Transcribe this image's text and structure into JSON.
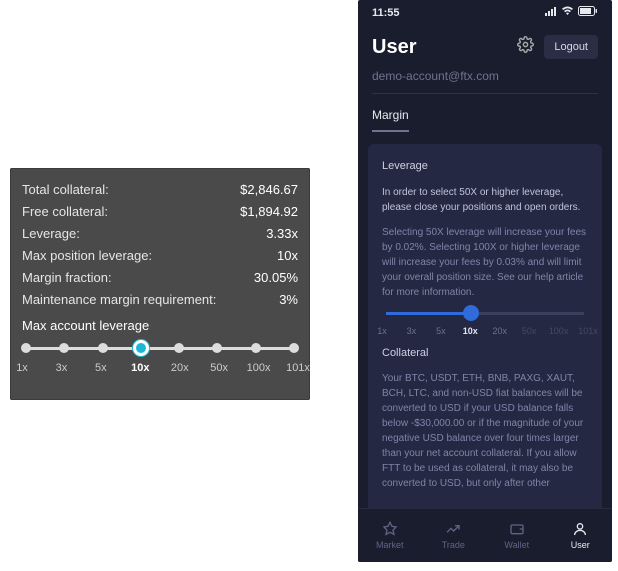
{
  "left": {
    "stats": [
      {
        "label": "Total collateral:",
        "value": "$2,846.67"
      },
      {
        "label": "Free collateral:",
        "value": "$1,894.92"
      },
      {
        "label": "Leverage:",
        "value": "3.33x"
      },
      {
        "label": "Max position leverage:",
        "value": "10x"
      },
      {
        "label": "Margin fraction:",
        "value": "30.05%"
      },
      {
        "label": "Maintenance margin requirement:",
        "value": "3%"
      }
    ],
    "slider_title": "Max account leverage",
    "options": [
      "1x",
      "3x",
      "5x",
      "10x",
      "20x",
      "50x",
      "100x",
      "101x"
    ],
    "selected_index": 3
  },
  "phone": {
    "time": "11:55",
    "status_icons": {
      "signal": "•ıll",
      "wifi": "⚡",
      "battery": "▢"
    },
    "title": "User",
    "logout": "Logout",
    "email": "demo-account@ftx.com",
    "tab": "Margin",
    "leverage_card": {
      "title": "Leverage",
      "line1": "In order to select 50X or higher leverage, please close your positions and open orders.",
      "line2": "Selecting 50X leverage will increase your fees by 0.02%. Selecting 100X or higher leverage will increase your fees by 0.03% and will limit your overall position size. See our help article for more information.",
      "options": [
        "1x",
        "3x",
        "5x",
        "10x",
        "20x",
        "50x",
        "100x",
        "101x"
      ],
      "selected_index": 3,
      "collateral_title": "Collateral",
      "collateral_text": "Your BTC, USDT, ETH, BNB, PAXG, XAUT, BCH, LTC, and non-USD fiat balances will be converted to USD if your USD balance falls below -$30,000.00 or if the magnitude of your negative USD balance over four times larger than your net account collateral. If you allow FTT to be used as collateral, it may also be converted to USD, but only after other"
    },
    "tabbar": [
      {
        "label": "Market"
      },
      {
        "label": "Trade"
      },
      {
        "label": "Wallet"
      },
      {
        "label": "User"
      }
    ],
    "active_tab": 3
  }
}
